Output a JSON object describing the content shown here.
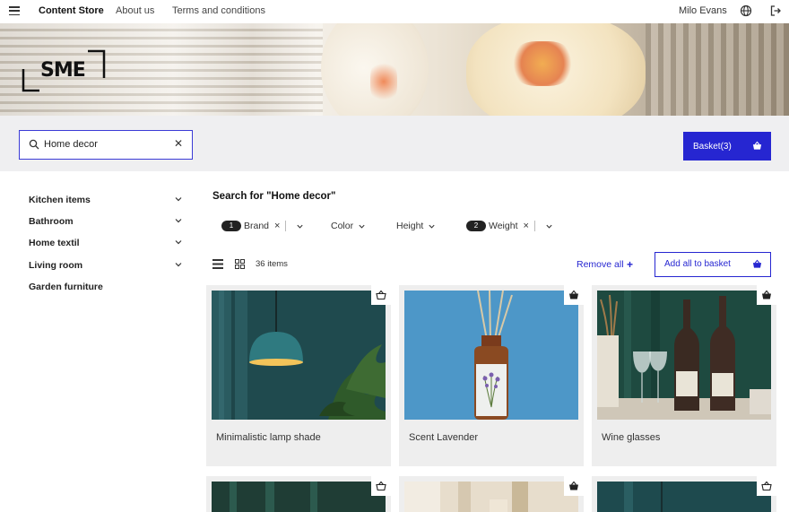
{
  "nav": {
    "brand": "Content Store",
    "links": [
      "About us",
      "Terms and conditions"
    ],
    "user": "Milo Evans"
  },
  "hero": {
    "logo_text": "SME"
  },
  "search": {
    "value": "Home decor",
    "placeholder": ""
  },
  "basket": {
    "label": "Basket(3)"
  },
  "sidebar": {
    "items": [
      {
        "label": "Kitchen items",
        "expandable": true
      },
      {
        "label": "Bathroom",
        "expandable": true
      },
      {
        "label": "Home textil",
        "expandable": true
      },
      {
        "label": "Living room",
        "expandable": true
      },
      {
        "label": "Garden furniture",
        "expandable": false
      }
    ]
  },
  "results": {
    "title": "Search for \"Home decor\"",
    "filters": [
      {
        "label": "Brand",
        "count": "1",
        "active": true
      },
      {
        "label": "Color",
        "count": "",
        "active": false
      },
      {
        "label": "Height",
        "count": "",
        "active": false
      },
      {
        "label": "Weight",
        "count": "2",
        "active": true
      }
    ],
    "items_count": "36 items",
    "remove_all": "Remove all",
    "add_all": "Add all to basket"
  },
  "products": [
    {
      "name": "Minimalistic lamp shade",
      "in_basket": false
    },
    {
      "name": "Scent Lavender",
      "in_basket": true
    },
    {
      "name": "Wine glasses",
      "in_basket": true
    },
    {
      "name": "",
      "in_basket": false
    },
    {
      "name": "",
      "in_basket": true
    },
    {
      "name": "",
      "in_basket": false
    }
  ],
  "colors": {
    "accent": "#2626d1",
    "band": "#efeff1",
    "card": "#eeeeee"
  }
}
